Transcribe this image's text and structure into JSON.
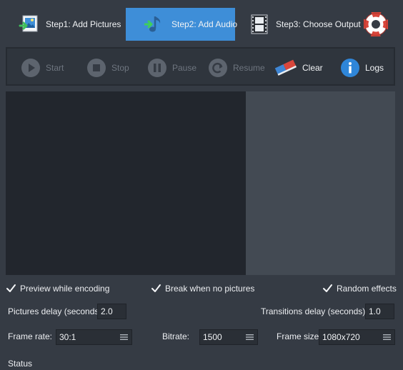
{
  "steps": [
    {
      "label": "Step1: Add Pictures",
      "icon": "add-pictures-icon",
      "active": false
    },
    {
      "label": "Step2: Add Audio",
      "icon": "add-audio-icon",
      "active": true
    },
    {
      "label": "Step3: Choose Output",
      "icon": "film-output-icon",
      "active": false
    }
  ],
  "help_icon": "lifebuoy-help-icon",
  "toolbar": {
    "start": "Start",
    "stop": "Stop",
    "pause": "Pause",
    "resume": "Resume",
    "clear": "Clear",
    "logs": "Logs"
  },
  "options": {
    "preview_while_encoding": "Preview while encoding",
    "break_when_no_pictures": "Break when no pictures",
    "random_effects": "Random effects",
    "pictures_delay_label": "Pictures delay (seconds)",
    "pictures_delay_value": "2.0",
    "transitions_delay_label": "Transitions delay (seconds)",
    "transitions_delay_value": "1.0",
    "frame_rate_label": "Frame rate:",
    "frame_rate_value": "30:1",
    "bitrate_label": "Bitrate:",
    "bitrate_value": "1500",
    "frame_size_label": "Frame size:",
    "frame_size_value": "1080x720"
  },
  "status_label": "Status",
  "colors": {
    "background": "#353b44",
    "active_tab": "#3e8ed8",
    "preview_dark": "#22262d",
    "preview_light": "#434a53",
    "clear_red": "#d9473c",
    "clear_blue": "#3f86d4",
    "info_blue": "#2f86d9"
  }
}
